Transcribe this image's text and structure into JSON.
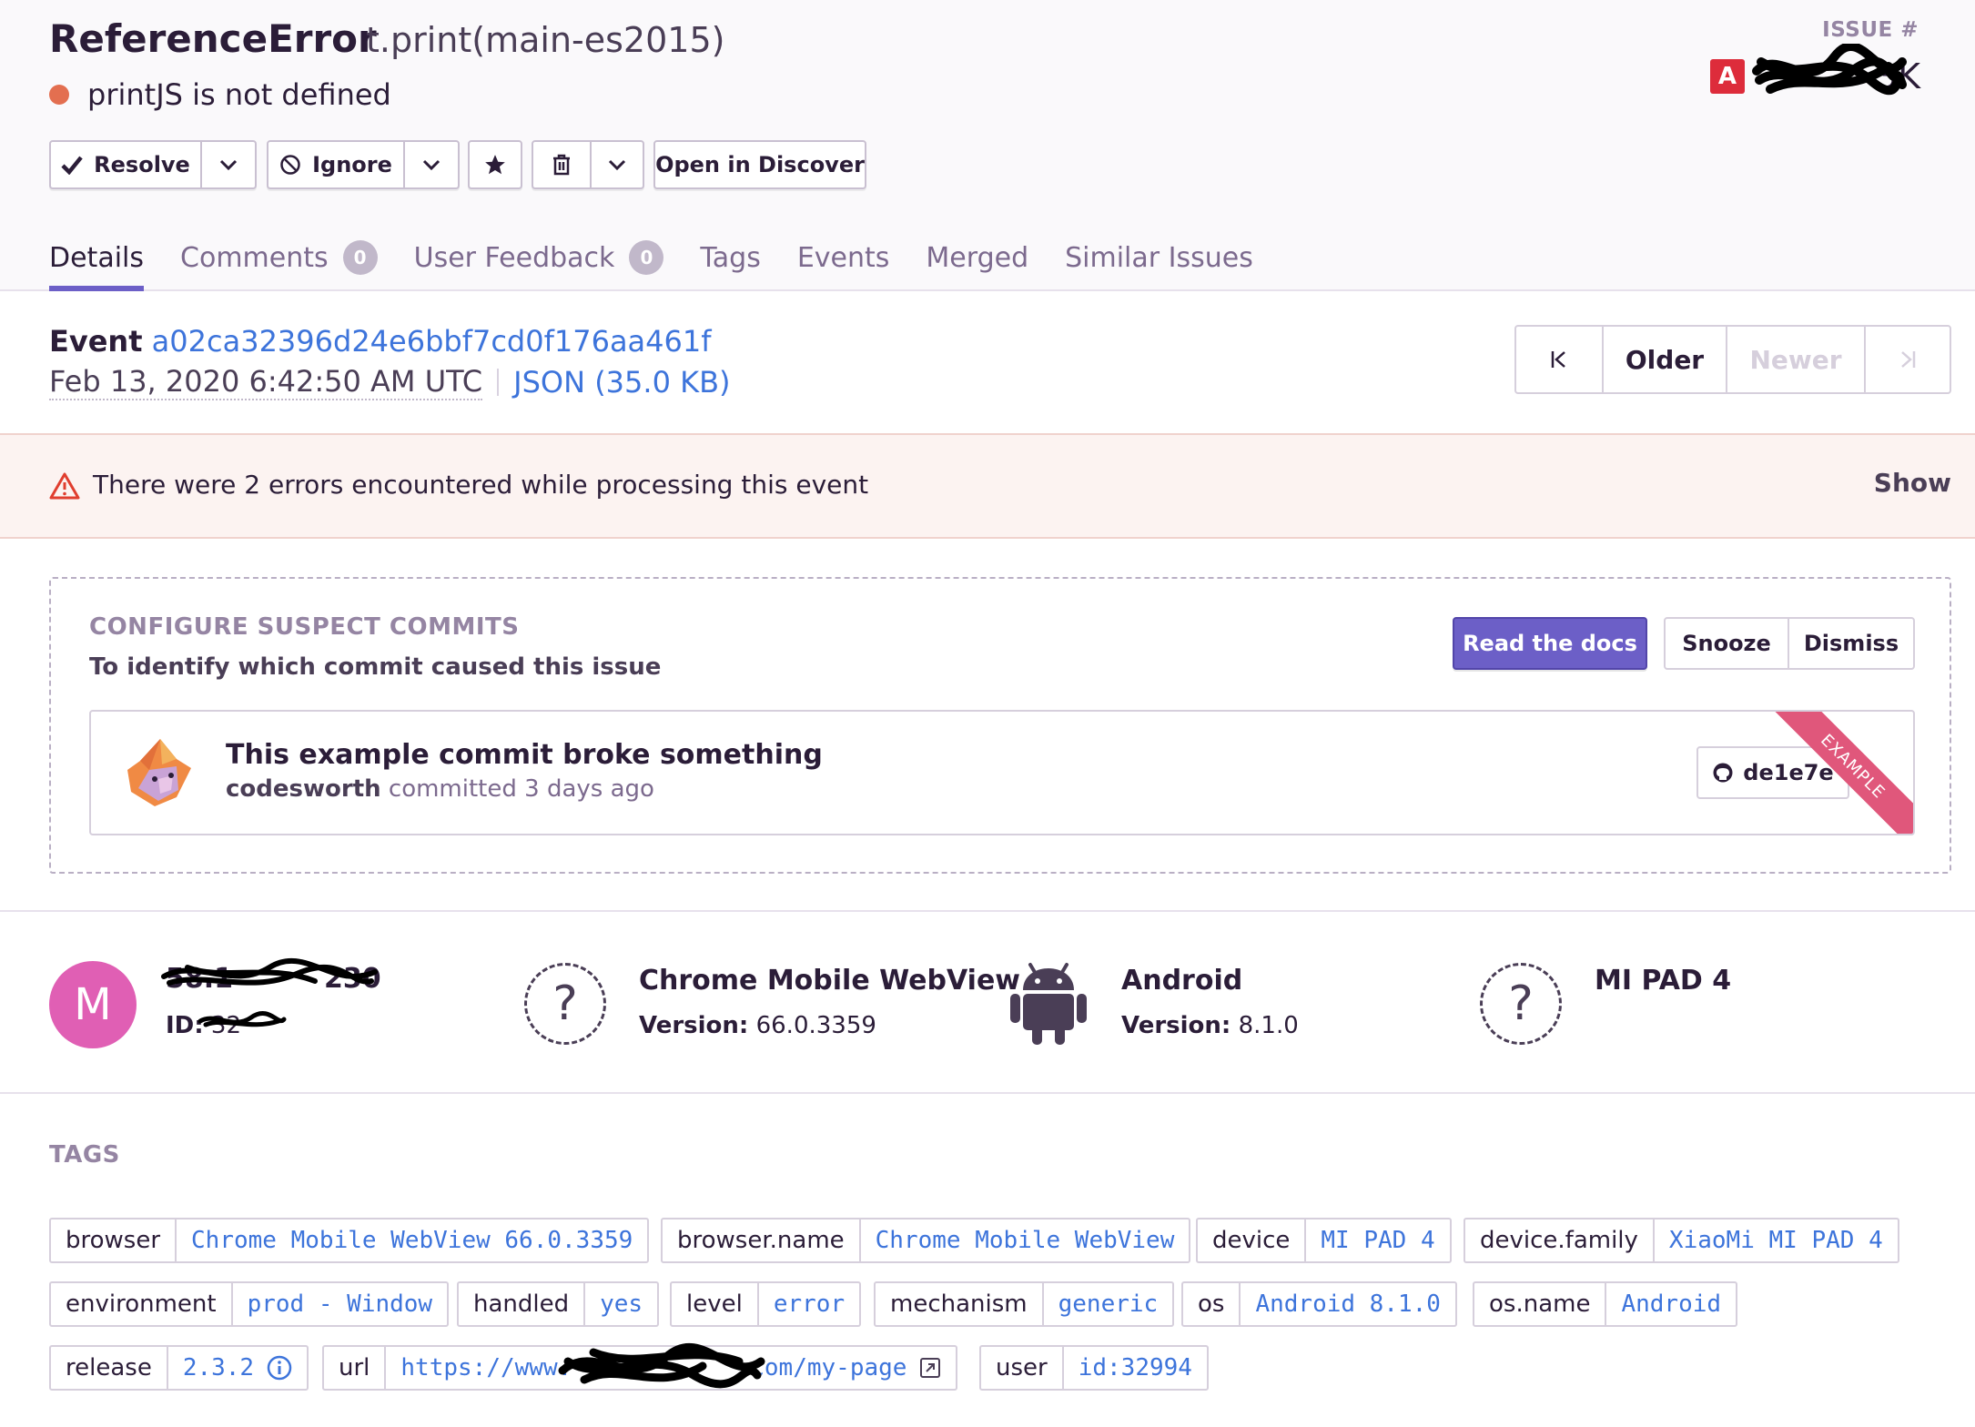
{
  "issue": {
    "type": "ReferenceError",
    "culprit": "t.print(main-es2015)",
    "message": "printJS is not defined",
    "issue_label": "ISSUE #",
    "issue_suffix": "3K",
    "platform_icon": "angular-icon"
  },
  "actions": {
    "resolve": "Resolve",
    "ignore": "Ignore",
    "open_discover": "Open in Discover"
  },
  "tabs": [
    {
      "label": "Details"
    },
    {
      "label": "Comments",
      "count": "0"
    },
    {
      "label": "User Feedback",
      "count": "0"
    },
    {
      "label": "Tags"
    },
    {
      "label": "Events"
    },
    {
      "label": "Merged"
    },
    {
      "label": "Similar Issues"
    }
  ],
  "event": {
    "label": "Event",
    "id": "a02ca32396d24e6bbf7cd0f176aa461f",
    "date": "Feb 13, 2020 6:42:50 AM UTC",
    "json": "JSON (35.0 KB)",
    "pager": {
      "older": "Older",
      "newer": "Newer"
    }
  },
  "errors_banner": {
    "text": "There were 2 errors encountered while processing this event",
    "action": "Show"
  },
  "suspect": {
    "title": "CONFIGURE SUSPECT COMMITS",
    "subtitle": "To identify which commit caused this issue",
    "read_docs": "Read the docs",
    "snooze": "Snooze",
    "dismiss": "Dismiss",
    "commit_title": "This example commit broke something",
    "commit_author": "codesworth",
    "commit_meta": "committed 3 days ago",
    "sha": "de1e7e",
    "ribbon": "EXAMPLE"
  },
  "context": {
    "user": {
      "avatar_letter": "M",
      "ip": "58.1",
      "ip_tail": "230",
      "id_label": "ID:",
      "id": "32"
    },
    "browser": {
      "name": "Chrome Mobile WebView",
      "version_label": "Version:",
      "version": "66.0.3359"
    },
    "os": {
      "name": "Android",
      "version_label": "Version:",
      "version": "8.1.0"
    },
    "device": {
      "name": "MI PAD 4"
    }
  },
  "tags_title": "TAGS",
  "tags": [
    {
      "key": "browser",
      "value": "Chrome Mobile WebView 66.0.3359"
    },
    {
      "key": "browser.name",
      "value": "Chrome Mobile WebView"
    },
    {
      "key": "device",
      "value": "MI PAD 4"
    },
    {
      "key": "device.family",
      "value": "XiaoMi MI PAD 4"
    },
    {
      "key": "environment",
      "value": "prod - Window"
    },
    {
      "key": "handled",
      "value": "yes"
    },
    {
      "key": "level",
      "value": "error"
    },
    {
      "key": "mechanism",
      "value": "generic"
    },
    {
      "key": "os",
      "value": "Android 8.1.0"
    },
    {
      "key": "os.name",
      "value": "Android"
    },
    {
      "key": "release",
      "value": "2.3.2"
    },
    {
      "key": "url",
      "value": "https://www.",
      "value_tail": "com/my-page"
    },
    {
      "key": "user",
      "value": "id:32994"
    }
  ],
  "colors": {
    "accent": "#6c5fc7",
    "link": "#3d74db",
    "status": "#e36f50",
    "error_bg": "#fcf3f1"
  }
}
